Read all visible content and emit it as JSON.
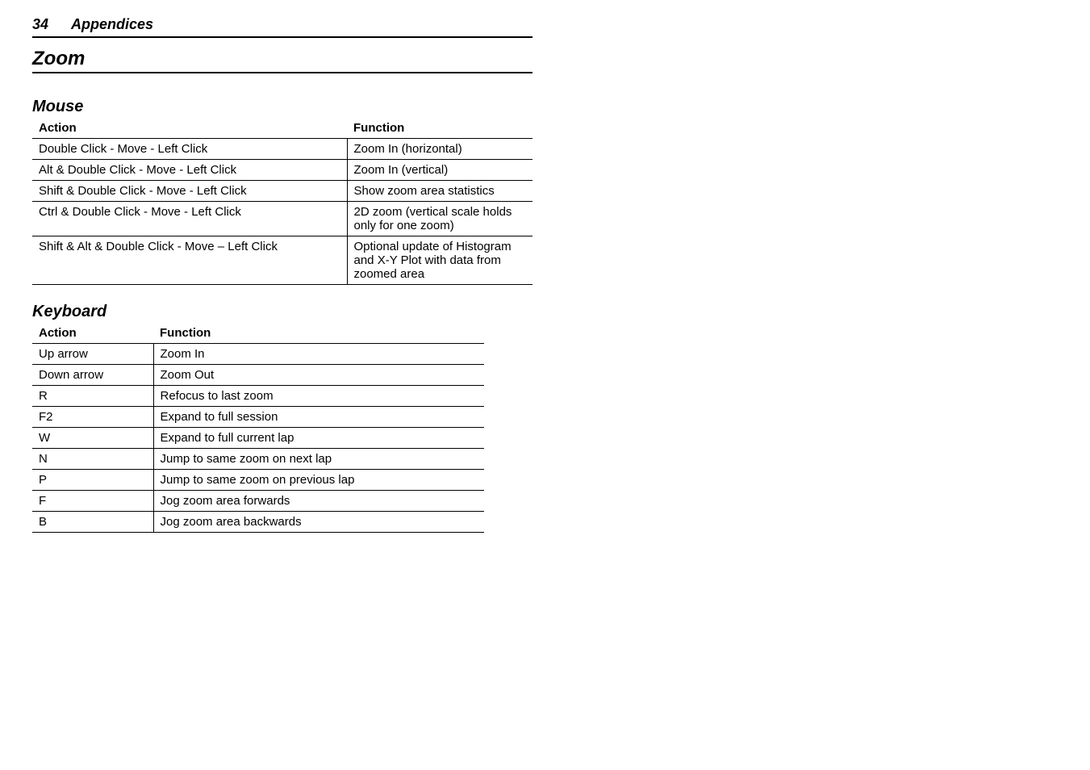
{
  "page_number": "34",
  "chapter": "Appendices",
  "section": "Zoom",
  "mouse": {
    "heading": "Mouse",
    "header_action": "Action",
    "header_function": "Function",
    "rows": [
      {
        "action": "Double Click - Move - Left Click",
        "function": "Zoom In (horizontal)"
      },
      {
        "action": "Alt & Double Click - Move - Left Click",
        "function": "Zoom In (vertical)"
      },
      {
        "action": "Shift & Double Click - Move - Left Click",
        "function": "Show zoom area statistics"
      },
      {
        "action": "Ctrl & Double Click - Move - Left Click",
        "function": "2D zoom (vertical scale holds only for one zoom)"
      },
      {
        "action": "Shift & Alt & Double Click - Move – Left Click",
        "function": "Optional update of Histogram and X-Y Plot with data from zoomed area"
      }
    ]
  },
  "keyboard": {
    "heading": "Keyboard",
    "header_action": "Action",
    "header_function": "Function",
    "rows": [
      {
        "action": "Up arrow",
        "function": "Zoom In"
      },
      {
        "action": "Down arrow",
        "function": "Zoom Out"
      },
      {
        "action": "R",
        "function": "Refocus to last zoom"
      },
      {
        "action": "F2",
        "function": "Expand to full session"
      },
      {
        "action": "W",
        "function": "Expand to full current lap"
      },
      {
        "action": "N",
        "function": "Jump to same zoom on next lap"
      },
      {
        "action": "P",
        "function": "Jump to same zoom on previous lap"
      },
      {
        "action": "F",
        "function": "Jog zoom area forwards"
      },
      {
        "action": "B",
        "function": "Jog zoom area backwards"
      }
    ]
  }
}
